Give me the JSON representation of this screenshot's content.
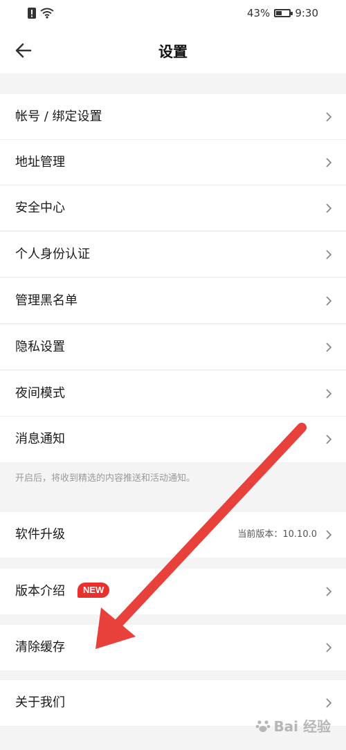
{
  "status_bar": {
    "battery_percent": "43%",
    "battery_level": 0.43,
    "time": "9:30"
  },
  "header": {
    "title": "设置"
  },
  "settings": {
    "account": "帐号 / 绑定设置",
    "address": "地址管理",
    "security": "安全中心",
    "identity": "个人身份认证",
    "blacklist": "管理黑名单",
    "privacy": "隐私设置",
    "night_mode": "夜间模式",
    "notifications": "消息通知",
    "notifications_hint": "开启后，将收到精选的内容推送和活动通知。",
    "upgrade": "软件升级",
    "current_version": "当前版本：10.10.0",
    "version_intro": "版本介绍",
    "new_badge": "NEW",
    "clear_cache": "清除缓存",
    "about": "关于我们"
  },
  "annotation": {
    "arrow_color": "#e8403a"
  },
  "watermark": {
    "text": "Bai  经验"
  }
}
